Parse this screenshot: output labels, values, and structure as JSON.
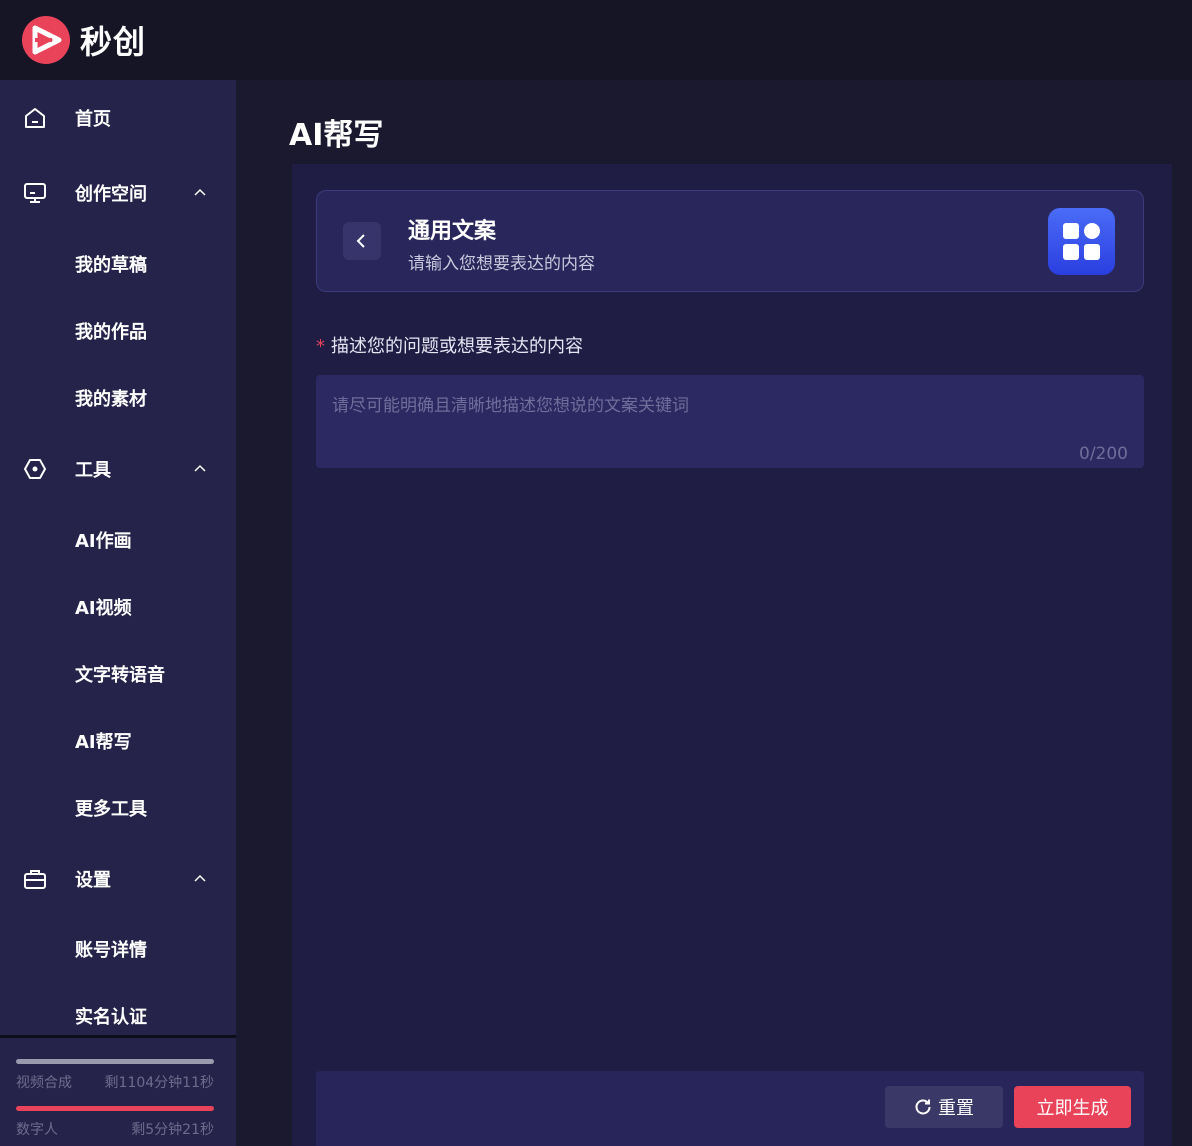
{
  "app": {
    "logo_text": "秒创",
    "brand_color": "#e9435a"
  },
  "sidebar": {
    "items": [
      {
        "label": "首页",
        "icon": "home-icon"
      },
      {
        "label": "创作空间",
        "icon": "monitor-icon",
        "expanded": true,
        "children": [
          "我的草稿",
          "我的作品",
          "我的素材"
        ]
      },
      {
        "label": "工具",
        "icon": "tool-icon",
        "expanded": true,
        "children": [
          "AI作画",
          "AI视频",
          "文字转语音",
          "AI帮写",
          "更多工具"
        ]
      },
      {
        "label": "设置",
        "icon": "briefcase-icon",
        "expanded": true,
        "children": [
          "账号详情",
          "实名认证"
        ]
      }
    ],
    "usage": [
      {
        "label": "视频合成",
        "remaining": "剩1104分钟11秒",
        "color": "#9a99ad"
      },
      {
        "label": "数字人",
        "remaining": "剩5分钟21秒",
        "color": "#e9435a"
      }
    ]
  },
  "main": {
    "page_title": "AI帮写",
    "card": {
      "title": "通用文案",
      "subtitle": "请输入您想要表达的内容",
      "icon": "grid-apps-icon"
    },
    "field": {
      "required_mark": "*",
      "label": "描述您的问题或想要表达的内容",
      "placeholder": "请尽可能明确且清晰地描述您想说的文案关键词",
      "value": "",
      "counter": "0/200"
    },
    "buttons": {
      "reset": "重置",
      "generate": "立即生成"
    }
  }
}
